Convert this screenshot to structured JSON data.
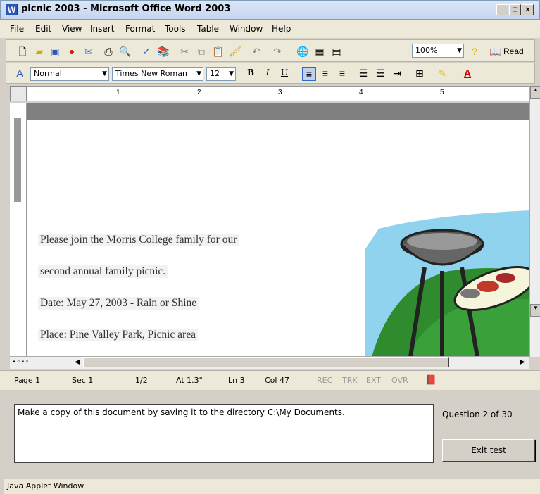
{
  "window": {
    "title": "picnic 2003 - Microsoft Office Word 2003",
    "minimize": "_",
    "maximize": "□",
    "close": "×"
  },
  "menu": {
    "items": [
      "File",
      "Edit",
      "View",
      "Insert",
      "Format",
      "Tools",
      "Table",
      "Window",
      "Help"
    ]
  },
  "toolbar": {
    "zoom": "100%",
    "read_label": "Read"
  },
  "formatting": {
    "style": "Normal",
    "font": "Times New Roman",
    "size": "12",
    "bold": "B",
    "italic": "I",
    "underline": "U",
    "font_color": "A"
  },
  "ruler": {
    "marks": [
      "1",
      "2",
      "3",
      "4",
      "5"
    ]
  },
  "document": {
    "lines": [
      "Please join the Morris College family for our",
      "second annual family picnic.",
      "Date:  May 27, 2003 - Rain or Shine",
      "Place:  Pine Valley Park, Picnic area"
    ]
  },
  "status": {
    "page": "Page  1",
    "sec": "Sec  1",
    "pages": "1/2",
    "at": "At  1.3\"",
    "ln": "Ln  3",
    "col": "Col  47",
    "rec": "REC",
    "trk": "TRK",
    "ext": "EXT",
    "ovr": "OVR"
  },
  "applet": {
    "instruction": "Make a copy of this document by saving it to the directory C:\\My Documents.",
    "question": "Question 2 of 30",
    "exit_label": "Exit test",
    "java_label": "Java Applet Window"
  }
}
